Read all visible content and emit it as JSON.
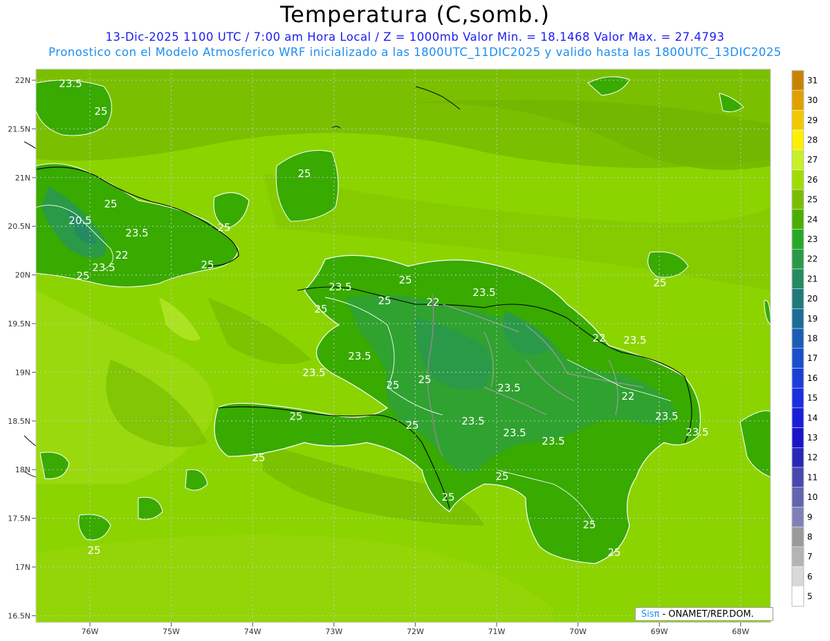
{
  "title": "Temperatura (C,somb.)",
  "subtitle_line1": "13-Dic-2025  1100 UTC / 7:00 am Hora Local / Z = 1000mb   Valor Min. = 18.1468  Valor Max. = 27.4793",
  "subtitle_line2": "Pronostico con el Modelo Atmosferico WRF inicializado a las 1800UTC_11DIC2025 y valido hasta las  1800UTC_13DIC2025",
  "credit": {
    "brand": "Sisπ",
    "text": " - ONAMET/REP.DOM."
  },
  "lat_ticks": [
    "22N",
    "21.5N",
    "21N",
    "20.5N",
    "20N",
    "19.5N",
    "19N",
    "18.5N",
    "18N",
    "17.5N",
    "17N",
    "16.5N"
  ],
  "lon_ticks": [
    "76W",
    "75W",
    "74W",
    "73W",
    "72W",
    "71W",
    "70W",
    "69W",
    "68W"
  ],
  "colorbar": {
    "labels": [
      "31",
      "30",
      "29",
      "28",
      "27",
      "26",
      "25",
      "24",
      "23",
      "22",
      "21",
      "20",
      "19",
      "18",
      "17",
      "16",
      "15",
      "14",
      "13",
      "12",
      "11",
      "10",
      "9",
      "8",
      "7",
      "6",
      "5"
    ],
    "colors": [
      "#c88400",
      "#e0a000",
      "#f4c800",
      "#fcf000",
      "#c8f028",
      "#a0dc00",
      "#78be00",
      "#4aae00",
      "#28a828",
      "#2a9a48",
      "#268a60",
      "#1f7a7a",
      "#1a6e96",
      "#1a5eb4",
      "#1a4ecc",
      "#1a3ed8",
      "#1a2ee0",
      "#1a1ed8",
      "#1a14c8",
      "#2828b8",
      "#4848b0",
      "#6464b0",
      "#8080b8",
      "#9a9a9a",
      "#b4b4b4",
      "#d8d8d8",
      "#ffffff"
    ]
  },
  "contour_labels": [
    "23.5",
    "25",
    "25",
    "20.5",
    "23.5",
    "22",
    "23.5",
    "25",
    "25",
    "25",
    "25",
    "25",
    "23.5",
    "22",
    "25",
    "23.5",
    "22",
    "23.5",
    "23.5",
    "25",
    "25",
    "23.5",
    "22",
    "25",
    "23.5",
    "23.5",
    "23.5",
    "23.5",
    "23.5",
    "25",
    "25",
    "25",
    "25",
    "25",
    "25",
    "25",
    "25",
    "23.5",
    "25"
  ]
}
